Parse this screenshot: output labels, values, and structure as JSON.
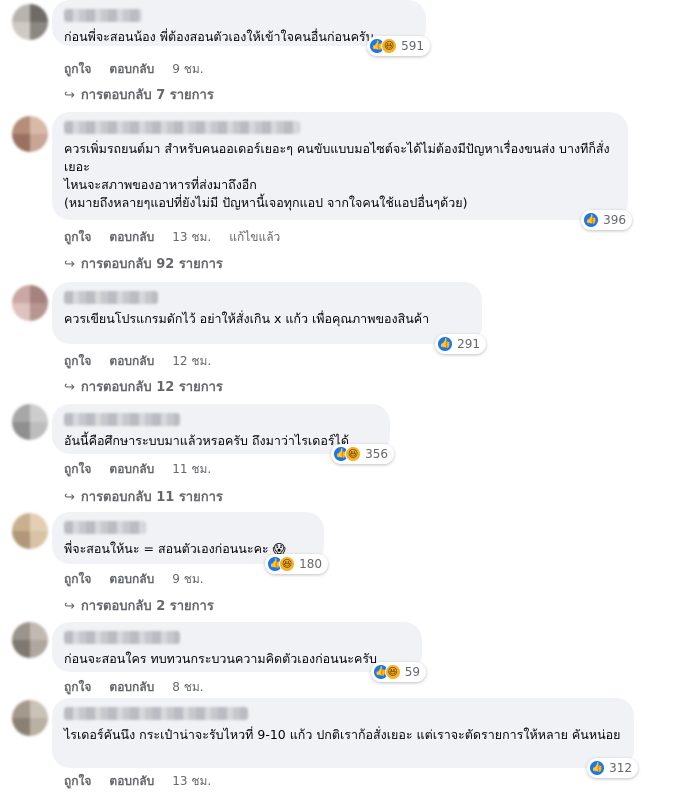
{
  "labels": {
    "like": "ถูกใจ",
    "reply": "ตอบกลับ",
    "replies_prefix": "การตอบกลับ",
    "replies_suffix": "รายการ"
  },
  "comments": [
    {
      "text": "ก่อนพี่จะสอนน้อง พี่ต้องสอนตัวเองให้เข้าใจคนอื่นก่อนครับ",
      "time": "9 ชม.",
      "edited": "",
      "reactions": [
        "like",
        "haha"
      ],
      "reaction_count": "591",
      "reply_count": "7"
    },
    {
      "text": "ควรเพิ่มรถยนต์มา สำหรับคนออเดอร์เยอะๆ คนขับแบบมอไซต์จะได้ไม่ต้องมีปัญหาเรื่องขนส่ง บางทีก็สั่งเยอะ\nไหนจะสภาพของอาหารที่ส่งมาถึงอีก\n(หมายถึงหลายๆแอปที่ยังไม่มี ปัญหานี้เจอทุกแอป จากใจคนใช้แอปอื่นๆด้วย)",
      "time": "13 ชม.",
      "edited": "แก้ไขแล้ว",
      "reactions": [
        "like"
      ],
      "reaction_count": "396",
      "reply_count": "92"
    },
    {
      "text": "ควรเขียนโปรแกรมดักไว้ อย่าให้สั่งเกิน x แก้ว เพื่อคุณภาพของสินค้า",
      "time": "12 ชม.",
      "edited": "",
      "reactions": [
        "like"
      ],
      "reaction_count": "291",
      "reply_count": "12"
    },
    {
      "text": "อันนี้คือศึกษาระบบมาแล้วหรอครับ ถึงมาว่าไรเดอร์ได้",
      "time": "11 ชม.",
      "edited": "",
      "reactions": [
        "like",
        "haha"
      ],
      "reaction_count": "356",
      "reply_count": "11"
    },
    {
      "text": "พี่จะสอนให้นะ = สอนตัวเองก่อนนะคะ 😱",
      "time": "9 ชม.",
      "edited": "",
      "reactions": [
        "like",
        "haha"
      ],
      "reaction_count": "180",
      "reply_count": "2"
    },
    {
      "text": "ก่อนจะสอนใคร ทบทวนกระบวนความคิดตัวเองก่อนนะครับ",
      "time": "8 ชม.",
      "edited": "",
      "reactions": [
        "like",
        "haha"
      ],
      "reaction_count": "59",
      "reply_count": ""
    },
    {
      "text": "ไรเดอร์คันนึง กระเป๋าน่าจะรับไหวที่ 9-10 แก้ว ปกติเราก้อสั่งเยอะ แต่เราจะตัดรายการให้หลาย คันหน่อย",
      "time": "13 ชม.",
      "edited": "",
      "reactions": [
        "like"
      ],
      "reaction_count": "312",
      "reply_count": ""
    }
  ]
}
